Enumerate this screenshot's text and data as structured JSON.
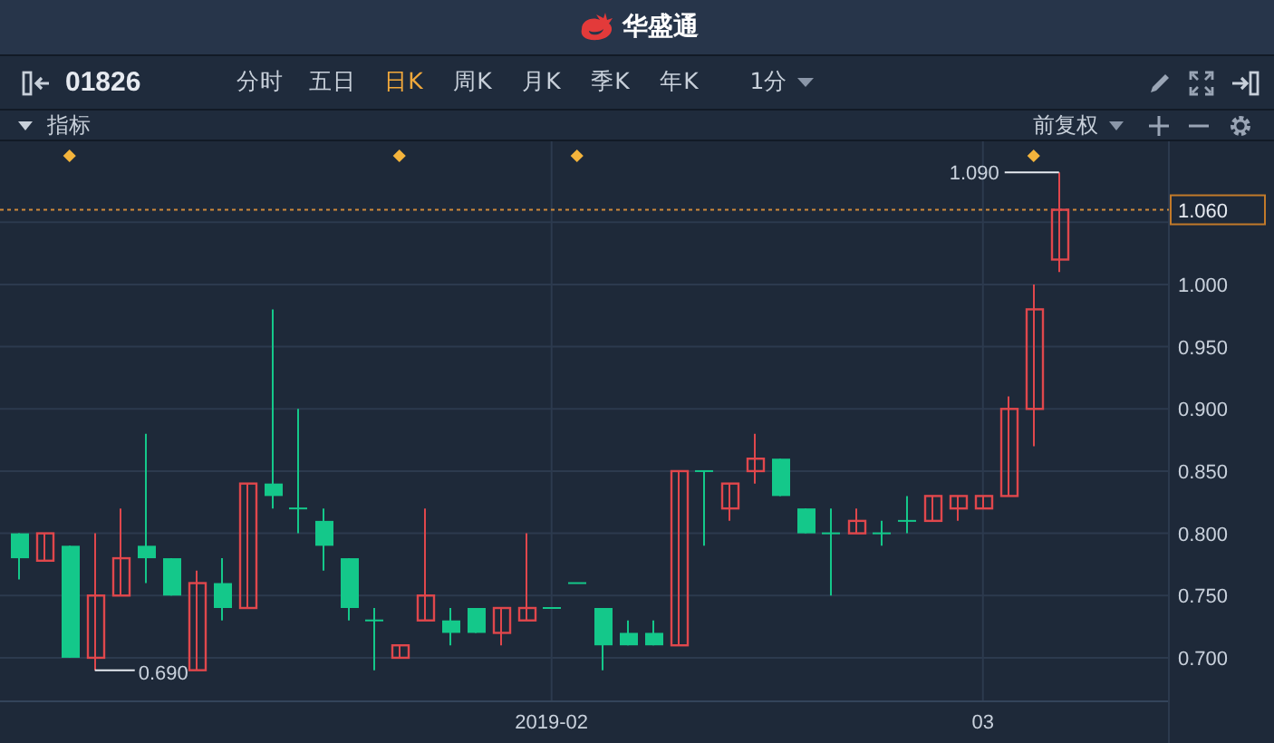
{
  "app_title": "华盛通",
  "toolbar": {
    "symbol": "01826",
    "periods": [
      {
        "label": "分时",
        "selected": false
      },
      {
        "label": "五日",
        "selected": false
      },
      {
        "label": "日K",
        "selected": true
      },
      {
        "label": "周K",
        "selected": false
      },
      {
        "label": "月K",
        "selected": false
      },
      {
        "label": "季K",
        "selected": false
      },
      {
        "label": "年K",
        "selected": false
      }
    ],
    "interval": "1分"
  },
  "indicator_bar": {
    "label": "指标",
    "adjustment": "前复权"
  },
  "chart": {
    "high_label": "1.090",
    "low_label": "0.690",
    "chart_data": {
      "type": "candlestick",
      "ylim": [
        0.665,
        1.115
      ],
      "categories": [
        null,
        null,
        null,
        null,
        null,
        null,
        null,
        null,
        null,
        null,
        null,
        null,
        null,
        null,
        null,
        null,
        null,
        null,
        null,
        null,
        null,
        "2019-02",
        null,
        null,
        null,
        null,
        null,
        null,
        null,
        null,
        null,
        null,
        null,
        null,
        null,
        null,
        null,
        null,
        "03",
        null,
        null,
        null
      ],
      "yticks": [
        {
          "value": 0.7,
          "label": "0.700"
        },
        {
          "value": 0.75,
          "label": "0.750"
        },
        {
          "value": 0.8,
          "label": "0.800"
        },
        {
          "value": 0.85,
          "label": "0.850"
        },
        {
          "value": 0.9,
          "label": "0.900"
        },
        {
          "value": 0.95,
          "label": "0.950"
        },
        {
          "value": 1.0,
          "label": "1.000"
        }
      ],
      "grid": true,
      "ref_lines": [
        {
          "axis": "y",
          "value": 1.06,
          "label": "1.060"
        }
      ],
      "ohlc": [
        [
          0.8,
          0.8,
          0.763,
          0.78
        ],
        [
          0.778,
          0.8,
          0.778,
          0.8
        ],
        [
          0.79,
          0.79,
          0.7,
          0.7
        ],
        [
          0.7,
          0.8,
          0.69,
          0.75
        ],
        [
          0.75,
          0.82,
          0.75,
          0.78
        ],
        [
          0.79,
          0.88,
          0.76,
          0.78
        ],
        [
          0.78,
          0.78,
          0.75,
          0.75
        ],
        [
          0.69,
          0.77,
          0.69,
          0.76
        ],
        [
          0.76,
          0.78,
          0.73,
          0.74
        ],
        [
          0.74,
          0.84,
          0.74,
          0.84
        ],
        [
          0.84,
          0.98,
          0.82,
          0.83
        ],
        [
          0.82,
          0.9,
          0.8,
          0.82
        ],
        [
          0.81,
          0.82,
          0.77,
          0.79
        ],
        [
          0.78,
          0.78,
          0.73,
          0.74
        ],
        [
          0.73,
          0.74,
          0.69,
          0.73
        ],
        [
          0.7,
          0.71,
          0.7,
          0.71
        ],
        [
          0.73,
          0.82,
          0.73,
          0.75
        ],
        [
          0.73,
          0.74,
          0.71,
          0.72
        ],
        [
          0.74,
          0.74,
          0.72,
          0.72
        ],
        [
          0.72,
          0.74,
          0.71,
          0.74
        ],
        [
          0.73,
          0.8,
          0.73,
          0.74
        ],
        [
          0.74,
          0.74,
          0.74,
          0.74
        ],
        [
          0.76,
          0.76,
          0.76,
          0.76
        ],
        [
          0.74,
          0.74,
          0.69,
          0.71
        ],
        [
          0.72,
          0.73,
          0.71,
          0.71
        ],
        [
          0.72,
          0.73,
          0.71,
          0.71
        ],
        [
          0.71,
          0.85,
          0.71,
          0.85
        ],
        [
          0.85,
          0.85,
          0.79,
          0.85
        ],
        [
          0.82,
          0.84,
          0.81,
          0.84
        ],
        [
          0.85,
          0.88,
          0.84,
          0.86
        ],
        [
          0.86,
          0.86,
          0.83,
          0.83
        ],
        [
          0.82,
          0.82,
          0.8,
          0.8
        ],
        [
          0.8,
          0.82,
          0.75,
          0.8
        ],
        [
          0.8,
          0.82,
          0.8,
          0.81
        ],
        [
          0.8,
          0.81,
          0.79,
          0.8
        ],
        [
          0.81,
          0.83,
          0.8,
          0.81
        ],
        [
          0.81,
          0.83,
          0.81,
          0.83
        ],
        [
          0.82,
          0.83,
          0.81,
          0.83
        ],
        [
          0.82,
          0.83,
          0.82,
          0.83
        ],
        [
          0.83,
          0.91,
          0.83,
          0.9
        ],
        [
          0.9,
          1.0,
          0.87,
          0.98
        ],
        [
          1.02,
          1.09,
          1.01,
          1.06
        ]
      ]
    }
  }
}
